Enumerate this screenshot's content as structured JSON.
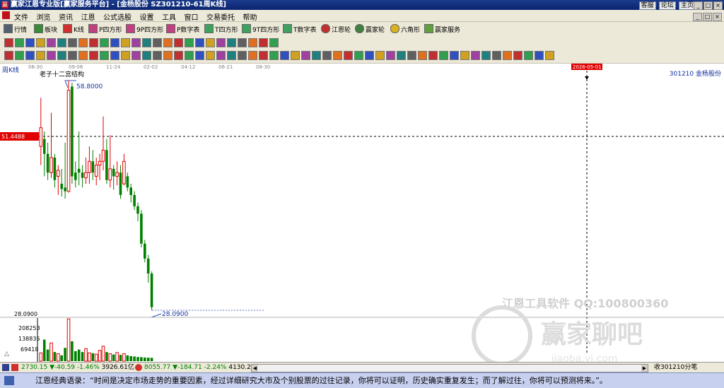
{
  "window": {
    "app_icon_char": "赢",
    "title": "赢家江恩专业版[赢家服务平台] - [金杨股份  SZ301210-61周K线]",
    "links": [
      "客服",
      "论坛",
      "主页"
    ]
  },
  "menu": {
    "items": [
      "文件",
      "浏览",
      "资讯",
      "江恩",
      "公式选股",
      "设置",
      "工具",
      "窗口",
      "交易委托",
      "帮助"
    ]
  },
  "toolbar1": {
    "buttons": [
      "行情",
      "板块",
      "K线",
      "P四方形",
      "9P四方形",
      "P数字表",
      "T四方形",
      "9T四方形",
      "T数字表",
      "江恩轮",
      "赢家轮",
      "六角形",
      "赢家服务"
    ]
  },
  "chart": {
    "period_label": "周K线",
    "stock_label": "301210  金杨股份",
    "indicator_label": "老子十二宫结构",
    "date_labels": [
      "06-30",
      "09-06",
      "11-24",
      "02-02",
      "04-12",
      "06-21",
      "08-30"
    ],
    "cursor_date": "2026-05-01",
    "cursor_price": "51.4488",
    "high_label": "58.8000",
    "low_label": "28.0900",
    "low_axis_label": "28.0900",
    "vol_labels": [
      "208253",
      "138835",
      "69418"
    ],
    "watermark_title": "江恩工具软件  QQ:100800360",
    "watermark_logo": "赢家聊吧",
    "watermark_url": "jiaoba.yj.com",
    "colors": {
      "up": "#e00000",
      "down": "#008000",
      "cursor_box": "#e00000"
    }
  },
  "chart_data": {
    "type": "candlestick",
    "title": "老子十二宫结构",
    "high": 58.8,
    "low": 28.09,
    "cursor_price": 51.4488,
    "candles": [
      {
        "o": 50.0,
        "c": 52.5,
        "h": 56.5,
        "l": 47.5
      },
      {
        "o": 51.0,
        "c": 49.0,
        "h": 52.0,
        "l": 46.0
      },
      {
        "o": 49.0,
        "c": 46.5,
        "h": 50.5,
        "l": 45.5
      },
      {
        "o": 46.5,
        "c": 48.5,
        "h": 54.5,
        "l": 45.8
      },
      {
        "o": 48.5,
        "c": 45.5,
        "h": 49.0,
        "l": 44.5
      },
      {
        "o": 46.0,
        "c": 46.8,
        "h": 47.5,
        "l": 43.5
      },
      {
        "o": 45.0,
        "c": 44.3,
        "h": 47.0,
        "l": 43.3
      },
      {
        "o": 44.5,
        "c": 44.0,
        "h": 50.5,
        "l": 43.0
      },
      {
        "o": 44.0,
        "c": 57.5,
        "h": 58.8,
        "l": 43.8
      },
      {
        "o": 58.0,
        "c": 46.0,
        "h": 58.5,
        "l": 45.0
      },
      {
        "o": 46.5,
        "c": 45.5,
        "h": 48.0,
        "l": 44.5
      },
      {
        "o": 47.0,
        "c": 46.5,
        "h": 52.0,
        "l": 44.8
      },
      {
        "o": 46.5,
        "c": 45.8,
        "h": 47.5,
        "l": 44.5
      },
      {
        "o": 45.8,
        "c": 46.5,
        "h": 48.5,
        "l": 45.0
      },
      {
        "o": 46.5,
        "c": 48.0,
        "h": 50.0,
        "l": 45.0
      },
      {
        "o": 48.0,
        "c": 46.5,
        "h": 49.5,
        "l": 45.5
      },
      {
        "o": 46.0,
        "c": 47.5,
        "h": 48.5,
        "l": 44.8
      },
      {
        "o": 47.5,
        "c": 48.0,
        "h": 49.0,
        "l": 45.5
      },
      {
        "o": 48.0,
        "c": 49.5,
        "h": 54.0,
        "l": 46.8
      },
      {
        "o": 49.5,
        "c": 45.5,
        "h": 51.0,
        "l": 45.0
      },
      {
        "o": 45.5,
        "c": 47.0,
        "h": 51.5,
        "l": 44.5
      },
      {
        "o": 47.0,
        "c": 46.0,
        "h": 47.5,
        "l": 44.2
      },
      {
        "o": 46.0,
        "c": 46.5,
        "h": 48.0,
        "l": 44.8
      },
      {
        "o": 46.5,
        "c": 43.5,
        "h": 47.5,
        "l": 43.0
      },
      {
        "o": 45.0,
        "c": 48.0,
        "h": 49.0,
        "l": 44.8
      },
      {
        "o": 46.0,
        "c": 44.5,
        "h": 46.5,
        "l": 44.0
      },
      {
        "o": 44.5,
        "c": 43.5,
        "h": 45.0,
        "l": 42.5
      },
      {
        "o": 43.5,
        "c": 42.0,
        "h": 44.0,
        "l": 41.5
      },
      {
        "o": 42.0,
        "c": 41.0,
        "h": 42.5,
        "l": 40.0
      },
      {
        "o": 41.0,
        "c": 37.0,
        "h": 41.5,
        "l": 36.5
      },
      {
        "o": 37.0,
        "c": 35.0,
        "h": 37.5,
        "l": 34.5
      },
      {
        "o": 35.0,
        "c": 33.0,
        "h": 35.5,
        "l": 31.8
      },
      {
        "o": 33.0,
        "c": 28.5,
        "h": 33.3,
        "l": 28.09
      }
    ],
    "volume": [
      50000,
      130000,
      70000,
      110000,
      55000,
      45000,
      35000,
      80000,
      255000,
      120000,
      60000,
      70000,
      55000,
      75000,
      50000,
      48000,
      42000,
      65000,
      90000,
      55000,
      45000,
      40000,
      52000,
      38000,
      45000,
      35000,
      30000,
      28000,
      25000,
      24000,
      22000,
      21000,
      20000
    ],
    "volume_max": 260000
  },
  "statusbar": {
    "index1": "2730.15",
    "index1_chg": "-40.59",
    "index1_pct": "-1.46%",
    "index1_amt": "3926.61亿",
    "index2": "8055.77",
    "index2_chg": "-184.71",
    "index2_pct": "-2.24%",
    "index2_amt": "4130.2",
    "right_text": "收301210分笔"
  },
  "footer": {
    "quote": "江恩经典语录：“时间是决定市场走势的重要因素，经过详细研究大市及个别股票的过往记录，你将可以证明，历史确实重复发生；而了解过往，你将可以预测将来。”。"
  }
}
